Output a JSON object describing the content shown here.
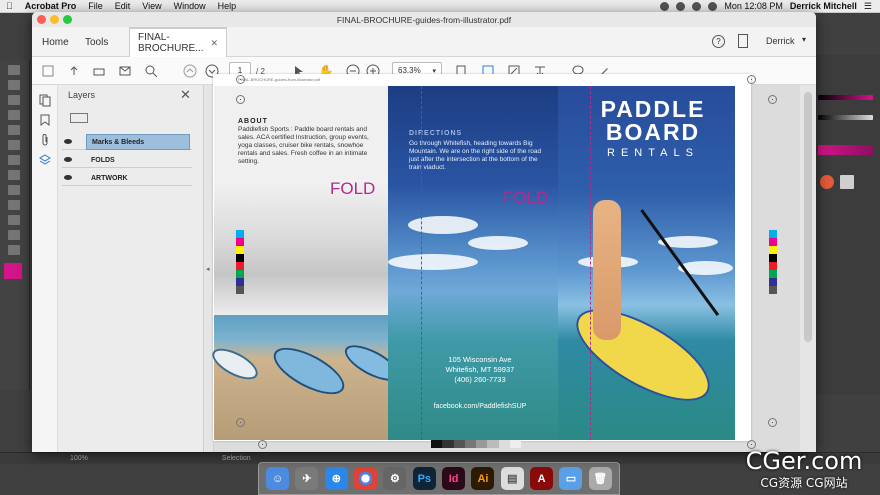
{
  "menubar": {
    "app_name": "Acrobat Pro",
    "items": [
      "File",
      "Edit",
      "View",
      "Window",
      "Help"
    ],
    "clock": "Mon 12:08 PM",
    "user": "Derrick Mitchell"
  },
  "window": {
    "title": "FINAL-BROCHURE-guides-from-illustrator.pdf"
  },
  "nav": {
    "home": "Home",
    "tools": "Tools",
    "doc_tab": "FINAL-BROCHURE...",
    "user": "Derrick"
  },
  "toolbar": {
    "page_current": "1",
    "page_total": "/  2",
    "zoom": "63.3%"
  },
  "layers_panel": {
    "title": "Layers",
    "layers": [
      {
        "name": "Marks & Bleeds",
        "selected": true
      },
      {
        "name": "FOLDS",
        "selected": false
      },
      {
        "name": "ARTWORK",
        "selected": false
      }
    ]
  },
  "brochure": {
    "file_slug": "FINAL-BROCHURE-guides-from-illustrator.pdf",
    "about_heading": "ABOUT",
    "about_body": "Paddlefish Sports : Paddle board rentals and sales. ACA certified Instruction, group events, yoga classes, cruiser bike rentals, snowhoe rentals and sales. Fresh coffee in an intimate setting.",
    "fold_left": "FOLD",
    "directions_heading": "DIRECTIONS",
    "directions_body": "Go through Whitefish, heading towards Big Mountain. We are on the right side of the road just after the intersection at the bottom of the train viaduct.",
    "fold_mid": "FOLD",
    "address_line1": "105 Wisconsin Ave",
    "address_line2": "Whitefish, MT 59937",
    "phone": "(406) 260-7733",
    "facebook": "facebook.com/PaddlefishSUP",
    "title_line1": "PADDLE",
    "title_line2": "BOARD",
    "title_line3": "RENTALS"
  },
  "illustrator_status": {
    "zoom": "100%",
    "mode": "Selection"
  },
  "watermark": {
    "line1": "CGer.com",
    "line2": "CG资源 CG网站"
  },
  "colors": {
    "fold_magenta": "#b02b8e",
    "layer_select": "#9dbfdb",
    "ocean_blue": "#2a55a3"
  }
}
